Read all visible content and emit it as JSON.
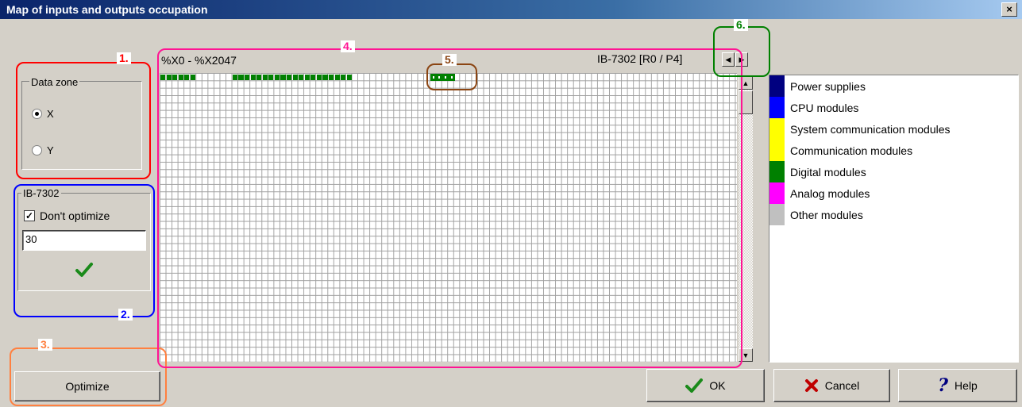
{
  "window": {
    "title": "Map of inputs and outputs occupation",
    "close_label": "×"
  },
  "data_zone": {
    "legend": "Data zone",
    "options": [
      {
        "label": "X",
        "selected": true
      },
      {
        "label": "Y",
        "selected": false
      }
    ]
  },
  "device_group": {
    "legend": "IB-7302",
    "dont_optimize_label": "Don't optimize",
    "dont_optimize_checked": true,
    "value": "30"
  },
  "map": {
    "range_label": "%X0 - %X2047",
    "device_label": "IB-7302 [R0 / P4]",
    "columns": 96,
    "occupied_runs": [
      {
        "start": 0,
        "length": 6,
        "color": "#008000"
      },
      {
        "start": 12,
        "length": 20,
        "color": "#008000"
      }
    ],
    "selected_run": {
      "start": 45,
      "length": 4,
      "color": "#008000"
    }
  },
  "legend_items": [
    {
      "label": "Power supplies",
      "color": "#000080"
    },
    {
      "label": "CPU modules",
      "color": "#0000ff"
    },
    {
      "label": "System communication modules",
      "color": "#ffff00"
    },
    {
      "label": "Communication modules",
      "color": "#ffff00"
    },
    {
      "label": "Digital modules",
      "color": "#008000"
    },
    {
      "label": "Analog modules",
      "color": "#ff00ff"
    },
    {
      "label": "Other modules",
      "color": "#c0c0c0"
    }
  ],
  "annotations": [
    {
      "num": "1.",
      "color": "#ff0000"
    },
    {
      "num": "2.",
      "color": "#0000ff"
    },
    {
      "num": "3.",
      "color": "#ff8040"
    },
    {
      "num": "4.",
      "color": "#ff1493"
    },
    {
      "num": "5.",
      "color": "#8b4513"
    },
    {
      "num": "6.",
      "color": "#008000"
    }
  ],
  "buttons": {
    "optimize": "Optimize",
    "ok": "OK",
    "cancel": "Cancel",
    "help": "Help"
  }
}
